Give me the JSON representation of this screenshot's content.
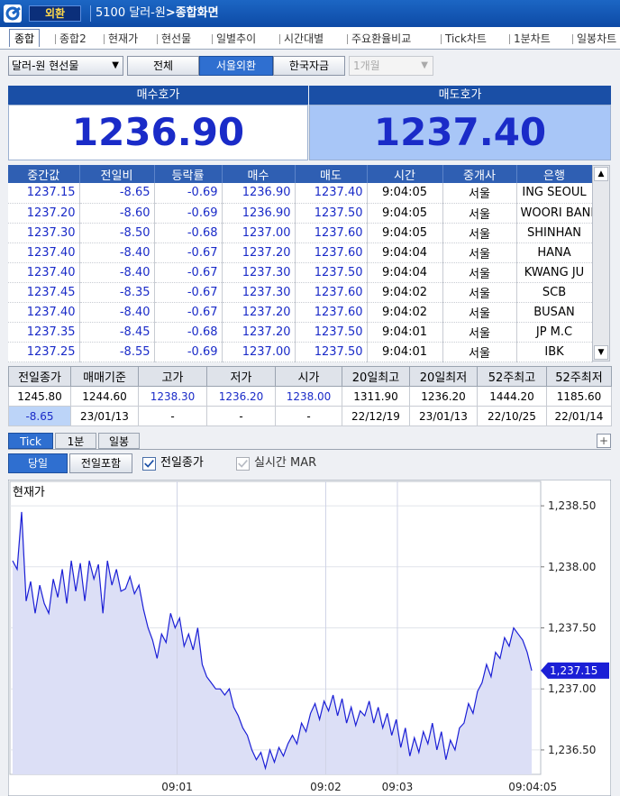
{
  "window": {
    "name": "외환",
    "code": "5100",
    "path_prefix": "달러-원",
    "path_current": "종합화면"
  },
  "tabs": [
    "종합",
    "종합2",
    "현재가",
    "현선물",
    "일별추이",
    "시간대별",
    "주요환율비교",
    "Tick차트",
    "1분차트",
    "일봉차트"
  ],
  "toolbar": {
    "product": "달러-원 현선물",
    "filters": [
      "전체",
      "서울외환",
      "한국자금"
    ],
    "selected_filter": "서울외환",
    "period": "1개월"
  },
  "quote": {
    "bid_label": "매수호가",
    "bid": "1236.90",
    "ask_label": "매도호가",
    "ask": "1237.40"
  },
  "trades": {
    "headers": [
      "중간값",
      "전일비",
      "등락률",
      "매수",
      "매도",
      "시간",
      "중개사",
      "은행"
    ],
    "rows": [
      [
        "1237.15",
        "-8.65",
        "-0.69",
        "1236.90",
        "1237.40",
        "9:04:05",
        "서울",
        "ING SEOUL"
      ],
      [
        "1237.20",
        "-8.60",
        "-0.69",
        "1236.90",
        "1237.50",
        "9:04:05",
        "서울",
        "WOORI BANK"
      ],
      [
        "1237.30",
        "-8.50",
        "-0.68",
        "1237.00",
        "1237.60",
        "9:04:05",
        "서울",
        "SHINHAN"
      ],
      [
        "1237.40",
        "-8.40",
        "-0.67",
        "1237.20",
        "1237.60",
        "9:04:04",
        "서울",
        "HANA"
      ],
      [
        "1237.40",
        "-8.40",
        "-0.67",
        "1237.30",
        "1237.50",
        "9:04:04",
        "서울",
        "KWANG JU"
      ],
      [
        "1237.45",
        "-8.35",
        "-0.67",
        "1237.30",
        "1237.60",
        "9:04:02",
        "서울",
        "SCB"
      ],
      [
        "1237.40",
        "-8.40",
        "-0.67",
        "1237.20",
        "1237.60",
        "9:04:02",
        "서울",
        "BUSAN"
      ],
      [
        "1237.35",
        "-8.45",
        "-0.68",
        "1237.20",
        "1237.50",
        "9:04:01",
        "서울",
        "JP M.C"
      ],
      [
        "1237.25",
        "-8.55",
        "-0.69",
        "1237.00",
        "1237.50",
        "9:04:01",
        "서울",
        "IBK"
      ]
    ]
  },
  "summary": {
    "headers": [
      "전일종가",
      "매매기준",
      "고가",
      "저가",
      "시가",
      "20일최고",
      "20일최저",
      "52주최고",
      "52주최저"
    ],
    "row1": [
      "1245.80",
      "1244.60",
      "1238.30",
      "1236.20",
      "1238.00",
      "1311.90",
      "1236.20",
      "1444.20",
      "1185.60"
    ],
    "row2": [
      "-8.65",
      "23/01/13",
      "-",
      "-",
      "-",
      "22/12/19",
      "23/01/13",
      "22/10/25",
      "22/01/14"
    ]
  },
  "chart_tabs": [
    "Tick",
    "1분",
    "일봉"
  ],
  "chart_options": {
    "day_buttons": [
      "당일",
      "전일포함"
    ],
    "prev_close_label": "전일종가",
    "prev_close_checked": true,
    "mar_label": "실시간 MAR",
    "mar_checked": false
  },
  "chart_data": {
    "type": "area",
    "title": "현재가",
    "series": [
      {
        "values": [
          1238.05,
          1237.98,
          1238.45,
          1237.72,
          1237.88,
          1237.62,
          1237.85,
          1237.7,
          1237.62,
          1237.9,
          1237.75,
          1237.98,
          1237.7,
          1238.05,
          1237.8,
          1238.03,
          1237.72,
          1238.05,
          1237.9,
          1238.02,
          1237.62,
          1238.05,
          1237.85,
          1237.98,
          1237.8,
          1237.82,
          1237.92,
          1237.78,
          1237.85,
          1237.65,
          1237.5,
          1237.4,
          1237.25,
          1237.45,
          1237.38,
          1237.62,
          1237.5,
          1237.58,
          1237.35,
          1237.45,
          1237.32,
          1237.5,
          1237.2,
          1237.1,
          1237.05,
          1237.0,
          1237.0,
          1236.95,
          1237.0,
          1236.85,
          1236.78,
          1236.68,
          1236.62,
          1236.5,
          1236.42,
          1236.48,
          1236.35,
          1236.5,
          1236.4,
          1236.52,
          1236.45,
          1236.55,
          1236.62,
          1236.55,
          1236.72,
          1236.65,
          1236.8,
          1236.88,
          1236.75,
          1236.9,
          1236.82,
          1236.95,
          1236.78,
          1236.92,
          1236.72,
          1236.85,
          1236.7,
          1236.82,
          1236.78,
          1236.9,
          1236.72,
          1236.85,
          1236.68,
          1236.8,
          1236.62,
          1236.75,
          1236.52,
          1236.68,
          1236.45,
          1236.6,
          1236.48,
          1236.65,
          1236.55,
          1236.72,
          1236.5,
          1236.65,
          1236.42,
          1236.58,
          1236.5,
          1236.68,
          1236.72,
          1236.88,
          1236.8,
          1236.98,
          1237.05,
          1237.2,
          1237.1,
          1237.3,
          1237.25,
          1237.42,
          1237.35,
          1237.5,
          1237.45,
          1237.4,
          1237.3,
          1237.15
        ]
      }
    ],
    "x_ticks": [
      "09:01",
      "09:02",
      "09:03",
      "09:04:05"
    ],
    "y_ticks": [
      "1,238.50",
      "1,238.00",
      "1,237.50",
      "1,237.00",
      "1,236.50"
    ],
    "ylim": [
      1236.3,
      1238.7
    ],
    "last_value": "1,237.15",
    "grid": true,
    "colors": {
      "fill": "#dcdff6",
      "line": "#1b1fd6",
      "marker": "#1b1fd6"
    }
  }
}
